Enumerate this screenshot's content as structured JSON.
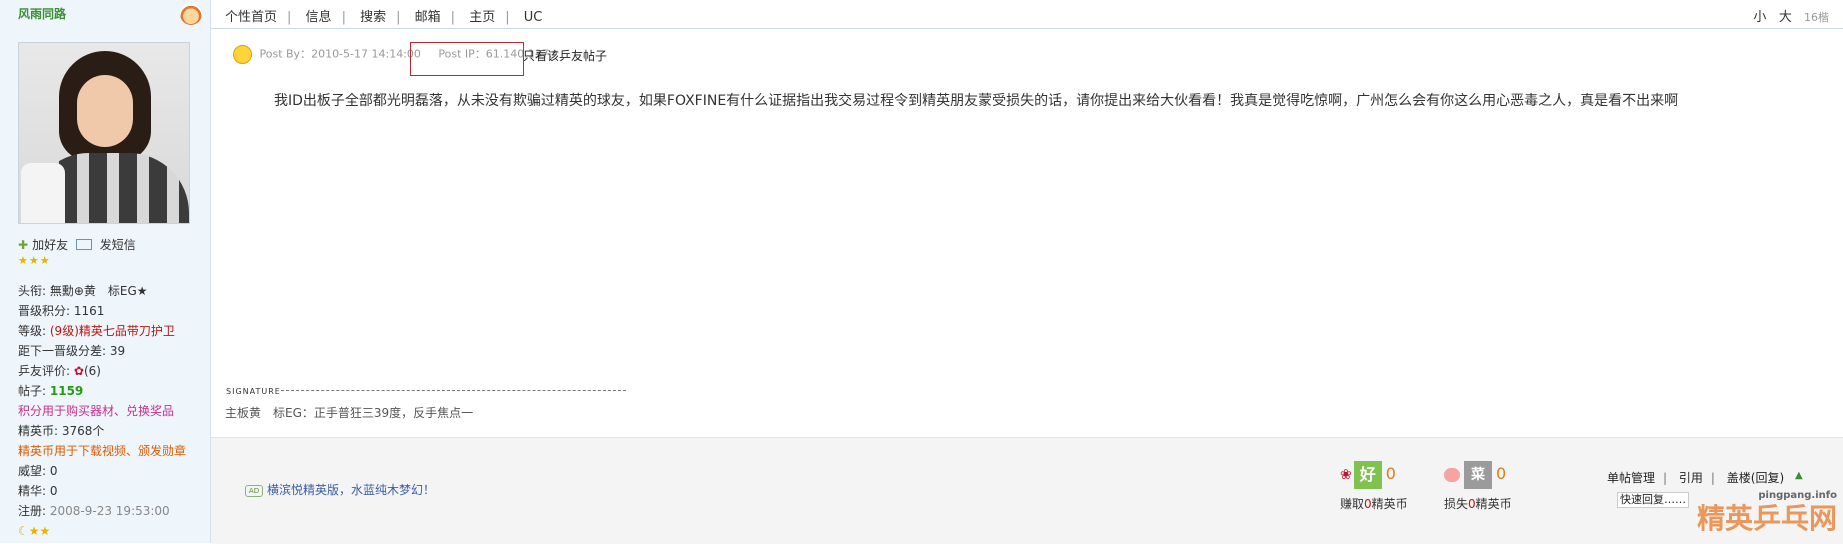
{
  "user": {
    "username": "风雨同路",
    "add_friend": "加好友",
    "send_message": "发短信",
    "stars": "★★★",
    "profile": [
      {
        "label": "头衔:",
        "value": "無勳⊕黄　标EG★"
      },
      {
        "label": "晋级积分:",
        "value": "1161"
      },
      {
        "label": "等级:",
        "value": "(9级)精英七品带刀护卫"
      },
      {
        "label": "距下一晋级分差:",
        "value": "39"
      },
      {
        "label": "乒友评价:",
        "value": "(6)"
      },
      {
        "label": "帖子:",
        "value": "1159"
      }
    ],
    "note_points": "积分用于购买器材、兑换奖品",
    "coins_label": "精英币:",
    "coins_value": "3768个",
    "note_coins": "精英币用于下载视频、颁发勋章",
    "prestige_label": "威望:",
    "prestige_value": "0",
    "essence_label": "精华:",
    "essence_value": "0",
    "register_label": "注册:",
    "register_value": "2008-9-23 19:53:00",
    "moon_stars": "☾★★"
  },
  "topnav": [
    "个性首页",
    "信息",
    "搜索",
    "邮箱",
    "主页",
    "UC"
  ],
  "font_controls": {
    "small": "小",
    "large": "大",
    "level": "16楷"
  },
  "post": {
    "post_by": "Post By：2010-5-17 14:14:00",
    "post_ip": "Post IP：61.140.137.*",
    "only_view": "只看该乒友帖子",
    "content": "我ID出板子全部都光明磊落，从未没有欺骗过精英的球友，如果FOXFINE有什么证据指出我交易过程令到精英朋友蒙受损失的话，请你提出来给大伙看看！我真是觉得吃惊啊，广州怎么会有你这么用心恶毒之人，真是看不出来啊"
  },
  "signature": {
    "label": "SIGNATURE",
    "text": "主板黄　标EG：正手普狂三39度，反手焦点一"
  },
  "footer": {
    "ad_text": "横滨悦精英版，水蓝纯木梦幻！",
    "good_count": "0",
    "good_label_prefix": "赚取",
    "good_label_num": "0",
    "good_label_suffix": "精英币",
    "bad_count": "0",
    "bad_label_prefix": "损失",
    "bad_label_num": "0",
    "bad_label_suffix": "精英币",
    "menu": [
      "单帖管理",
      "引用",
      "盖楼(回复)"
    ],
    "quick_reply": "快速回复……",
    "watermark_site": "pingpang.info",
    "watermark_text": "精英乒乓网"
  }
}
